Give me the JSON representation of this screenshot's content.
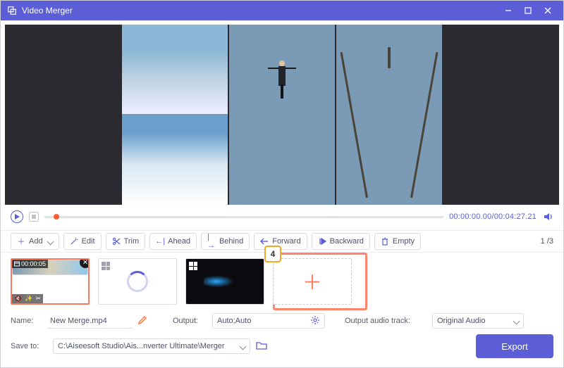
{
  "window": {
    "title": "Video Merger"
  },
  "player": {
    "current_time": "00:00:00.00",
    "duration": "00:04:27.21"
  },
  "toolbar": {
    "add": "Add",
    "edit": "Edit",
    "trim": "Trim",
    "ahead": "Ahead",
    "behind": "Behind",
    "forward": "Forward",
    "backward": "Backward",
    "empty": "Empty",
    "pager_current": "1",
    "pager_total": "3"
  },
  "clips": {
    "first_duration": "00:00:05",
    "step_badge": "4"
  },
  "bottom": {
    "name_label": "Name:",
    "name_value": "New Merge.mp4",
    "output_label": "Output:",
    "output_value": "Auto;Auto",
    "audio_label": "Output audio track:",
    "audio_value": "Original Audio",
    "saveto_label": "Save to:",
    "saveto_value": "C:\\Aiseesoft Studio\\Ais...nverter Ultimate\\Merger",
    "export": "Export"
  }
}
